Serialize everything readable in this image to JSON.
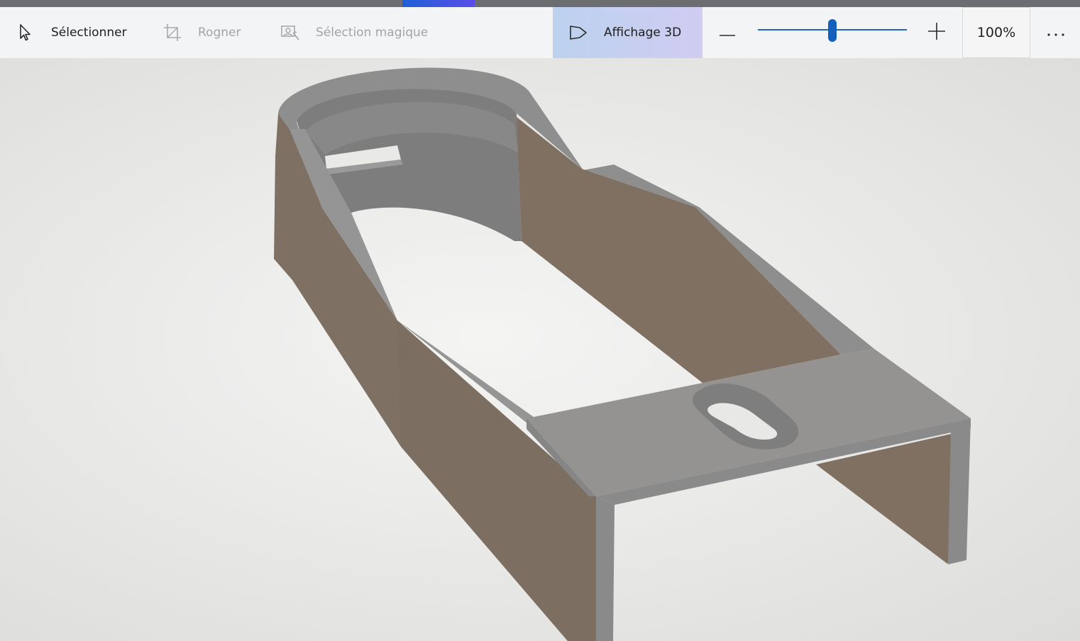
{
  "toolbar": {
    "select": {
      "label": "Sélectionner",
      "icon": "cursor-arrow-icon",
      "enabled": true
    },
    "crop": {
      "label": "Rogner",
      "icon": "crop-icon",
      "enabled": false
    },
    "magic_select": {
      "label": "Sélection magique",
      "icon": "magic-select-icon",
      "enabled": false
    },
    "view_3d": {
      "label": "Affichage 3D",
      "icon": "3d-view-icon",
      "active": true
    },
    "zoom": {
      "decrease_icon": "minus-icon",
      "increase_icon": "plus-icon",
      "value": "100%",
      "slider_level": 0.5
    },
    "more_icon": "ellipsis-icon"
  },
  "canvas": {
    "object": "3d-bracket-model",
    "colors": {
      "top_face": "#8f8f8f",
      "side_face": "#7f7062",
      "inner_wall": "#7a7a7a",
      "background": "#e8e8e6"
    }
  },
  "colors": {
    "accent": "#1560bd",
    "active_tab": "#c7d2f0",
    "toolbar_bg": "#f3f4f6"
  }
}
